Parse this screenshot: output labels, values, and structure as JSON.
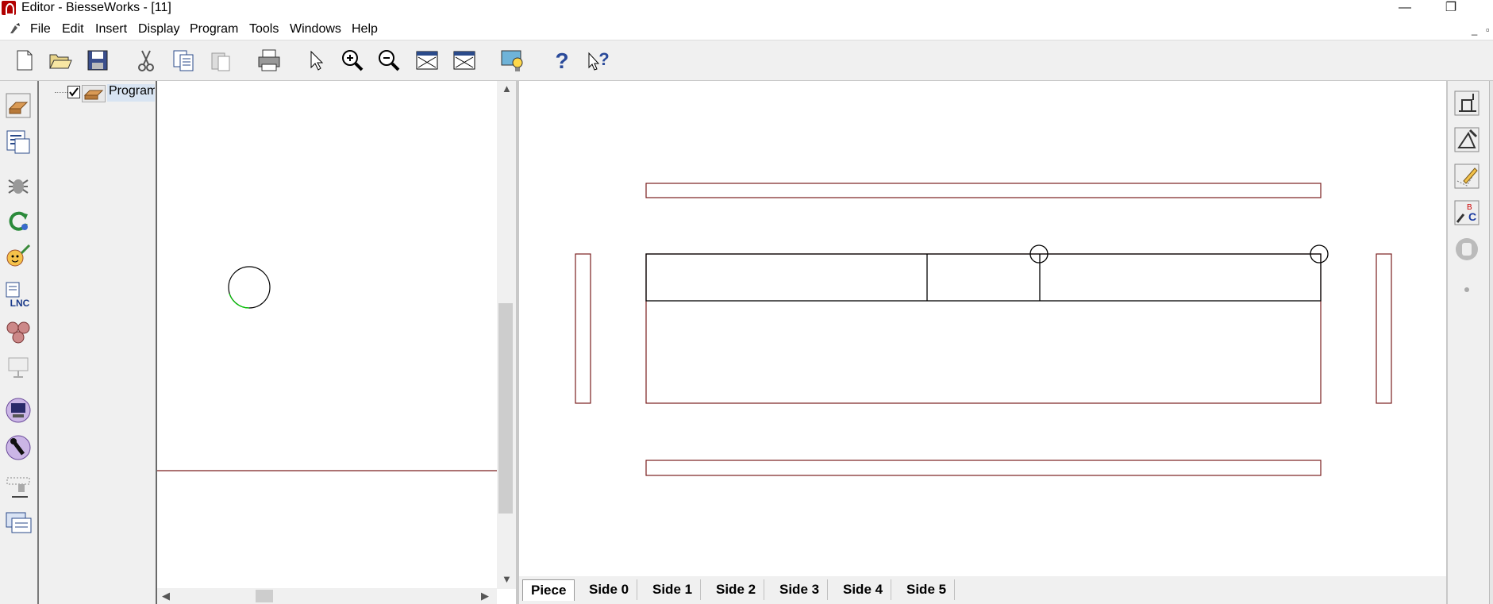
{
  "window": {
    "title": "Editor - BiesseWorks - [11]",
    "minimize_glyph": "—",
    "restore_glyph": "❐",
    "mdi_minimize_glyph": "_",
    "mdi_restore_glyph": "▫"
  },
  "menu": {
    "items": [
      "File",
      "Edit",
      "Insert",
      "Display",
      "Program",
      "Tools",
      "Windows",
      "Help"
    ]
  },
  "toolbar": {
    "buttons": [
      "new-icon",
      "open-icon",
      "save-icon",
      "cut-icon",
      "copy-icon",
      "paste-icon",
      "print-icon",
      "select-arrow-icon",
      "zoom-in-icon",
      "zoom-out-icon",
      "view-1-icon",
      "view-2-icon",
      "wizard-icon",
      "help-icon",
      "context-help-icon"
    ]
  },
  "left_toolbar": {
    "buttons": [
      "piece-icon",
      "list-icon",
      "bug-icon",
      "rotate-icon",
      "macro-icon",
      "nc-icon",
      "gears-icon",
      "presentation-icon",
      "computer-icon",
      "tool-icon",
      "machine-icon",
      "export-icon"
    ]
  },
  "tree": {
    "root_label": "Program",
    "root_checked": true
  },
  "tabs": {
    "items": [
      "Piece",
      "Side 0",
      "Side 1",
      "Side 2",
      "Side 3",
      "Side 4",
      "Side 5"
    ],
    "active": "Piece"
  },
  "right_toolbar": {
    "buttons": [
      "machine-setup-icon",
      "drawing-edit-icon",
      "pencil-icon",
      "spell-check-icon",
      "stop-hand-icon",
      "dot-icon"
    ]
  },
  "colors": {
    "piece_outline": "#7a1e1e",
    "geometry_line": "#000000",
    "preview_arc": "#00cc00",
    "selection": "#d8e4f2"
  }
}
